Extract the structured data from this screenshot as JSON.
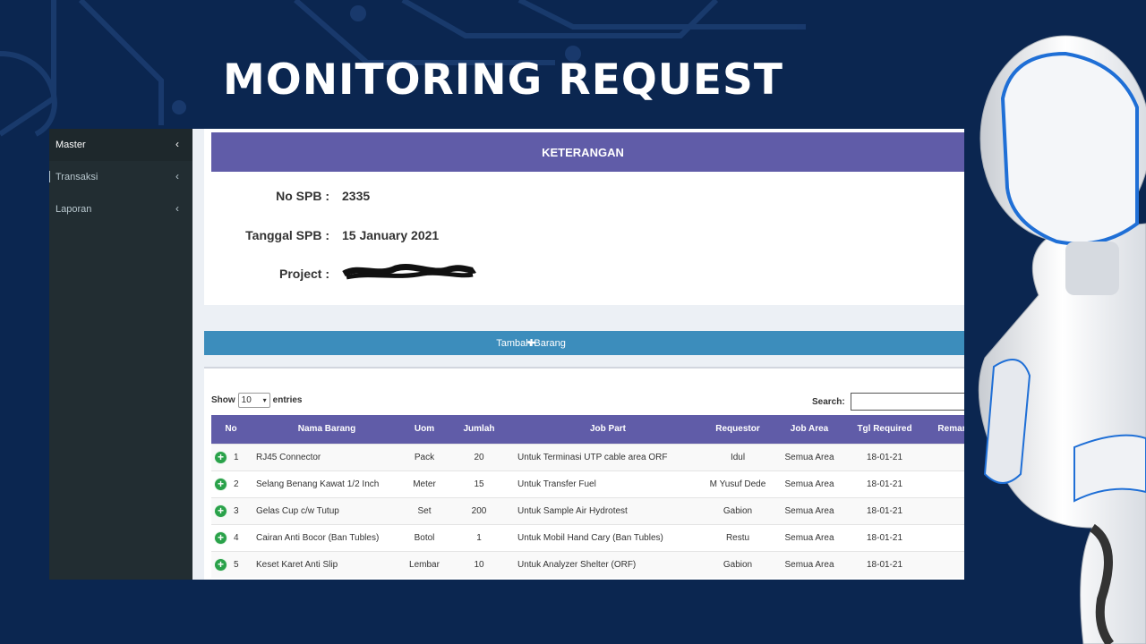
{
  "headline": "MONITORING REQUEST",
  "colors": {
    "background": "#0b2650",
    "header_purple": "#605ca8",
    "button_blue": "#3c8dbc",
    "sidebar": "#222d32",
    "add_icon": "#2aa24a"
  },
  "sidebar": {
    "items": [
      {
        "label": "Master",
        "icon": "chevron-left-icon"
      },
      {
        "label": "Transaksi",
        "icon": "chevron-left-icon"
      },
      {
        "label": "Laporan",
        "icon": "chevron-left-icon"
      }
    ]
  },
  "keterangan": {
    "title": "KETERANGAN",
    "no_spb_label": "No SPB :",
    "no_spb_value": "2335",
    "tanggal_label": "Tanggal SPB :",
    "tanggal_value": "15 January 2021",
    "project_label": "Project :"
  },
  "add_button": {
    "icon": "plus-icon",
    "label": "Tambah Barang"
  },
  "table_controls": {
    "show_label": "Show",
    "page_size": "10",
    "entries_label": "entries",
    "search_label": "Search:"
  },
  "table": {
    "columns": [
      "No",
      "Nama Barang",
      "Uom",
      "Jumlah",
      "Job Part",
      "Requestor",
      "Job Area",
      "Tgl Required",
      "Remar"
    ],
    "rows": [
      {
        "no": "1",
        "nama": "RJ45 Connector",
        "uom": "Pack",
        "jumlah": "20",
        "job_part": "Untuk Terminasi UTP cable area ORF",
        "requestor": "Idul",
        "job_area": "Semua Area",
        "tgl": "18-01-21",
        "remark": ""
      },
      {
        "no": "2",
        "nama": "Selang Benang Kawat 1/2 Inch",
        "uom": "Meter",
        "jumlah": "15",
        "job_part": "Untuk Transfer Fuel",
        "requestor": "M Yusuf Dede",
        "job_area": "Semua Area",
        "tgl": "18-01-21",
        "remark": ""
      },
      {
        "no": "3",
        "nama": "Gelas Cup c/w Tutup",
        "uom": "Set",
        "jumlah": "200",
        "job_part": "Untuk Sample Air Hydrotest",
        "requestor": "Gabion",
        "job_area": "Semua Area",
        "tgl": "18-01-21",
        "remark": ""
      },
      {
        "no": "4",
        "nama": "Cairan Anti Bocor (Ban Tubles)",
        "uom": "Botol",
        "jumlah": "1",
        "job_part": "Untuk Mobil Hand Cary (Ban Tubles)",
        "requestor": "Restu",
        "job_area": "Semua Area",
        "tgl": "18-01-21",
        "remark": ""
      },
      {
        "no": "5",
        "nama": "Keset Karet Anti Slip",
        "uom": "Lembar",
        "jumlah": "10",
        "job_part": "Untuk Analyzer Shelter (ORF)",
        "requestor": "Gabion",
        "job_area": "Semua Area",
        "tgl": "18-01-21",
        "remark": ""
      }
    ]
  }
}
